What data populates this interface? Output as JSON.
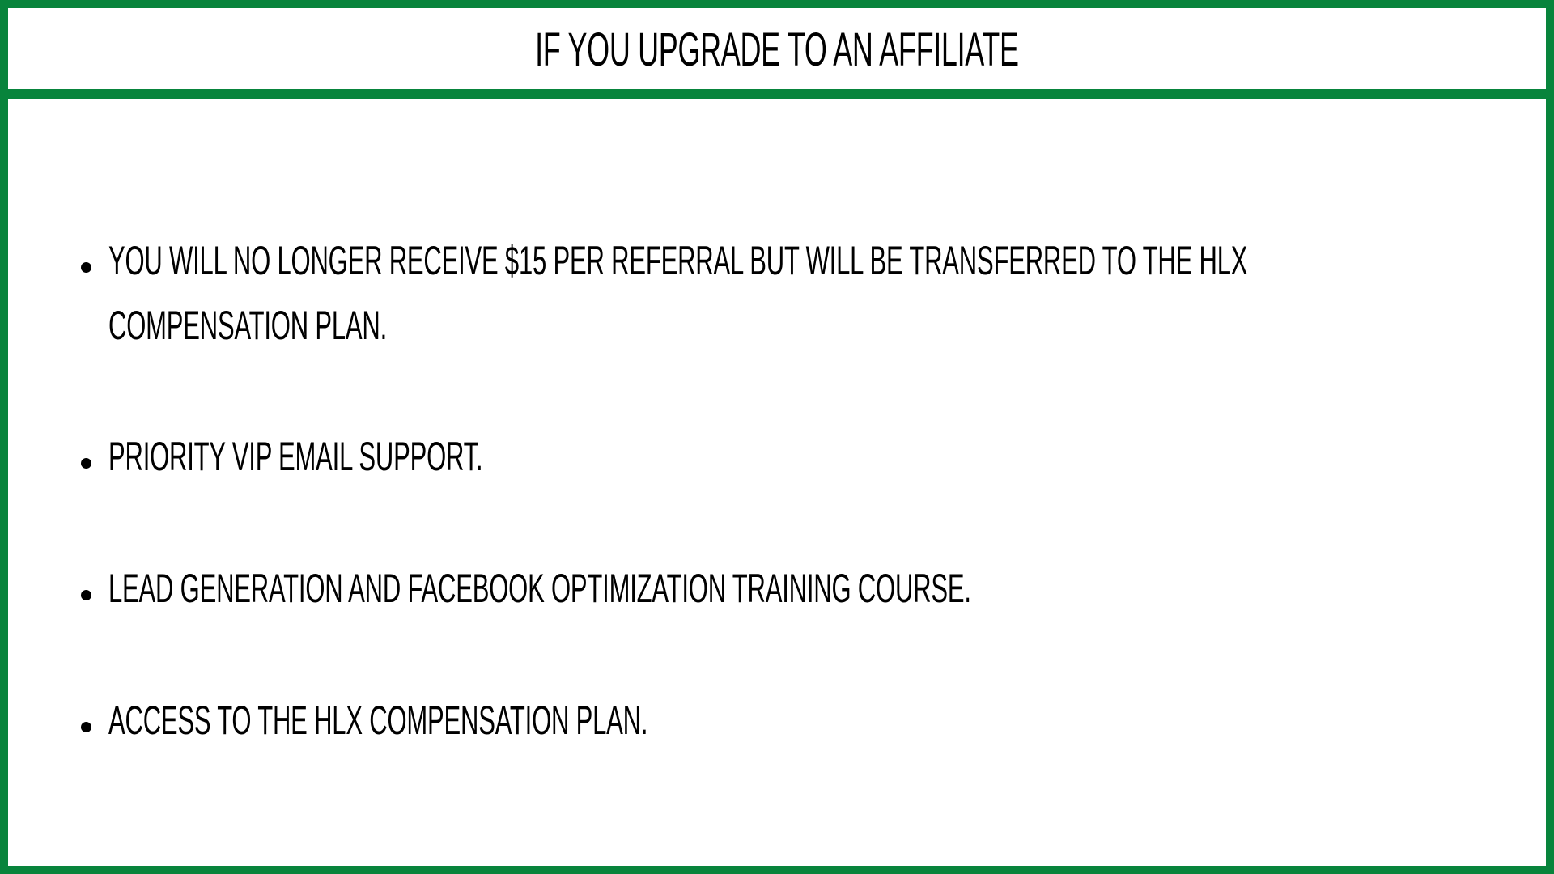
{
  "slide": {
    "title": "IF YOU UPGRADE TO AN AFFILIATE",
    "bullets": [
      {
        "lines": [
          "YOU WILL NO LONGER RECEIVE $15 PER REFERRAL BUT WILL BE TRANSFERRED TO THE HLX",
          "COMPENSATION PLAN."
        ]
      },
      {
        "lines": [
          "PRIORITY VIP EMAIL SUPPORT."
        ]
      },
      {
        "lines": [
          "LEAD GENERATION AND FACEBOOK OPTIMIZATION TRAINING COURSE."
        ]
      },
      {
        "lines": [
          "ACCESS TO THE HLX COMPENSATION PLAN."
        ]
      }
    ]
  },
  "colors": {
    "border": "#08843c",
    "text": "#000000",
    "background": "#ffffff"
  }
}
